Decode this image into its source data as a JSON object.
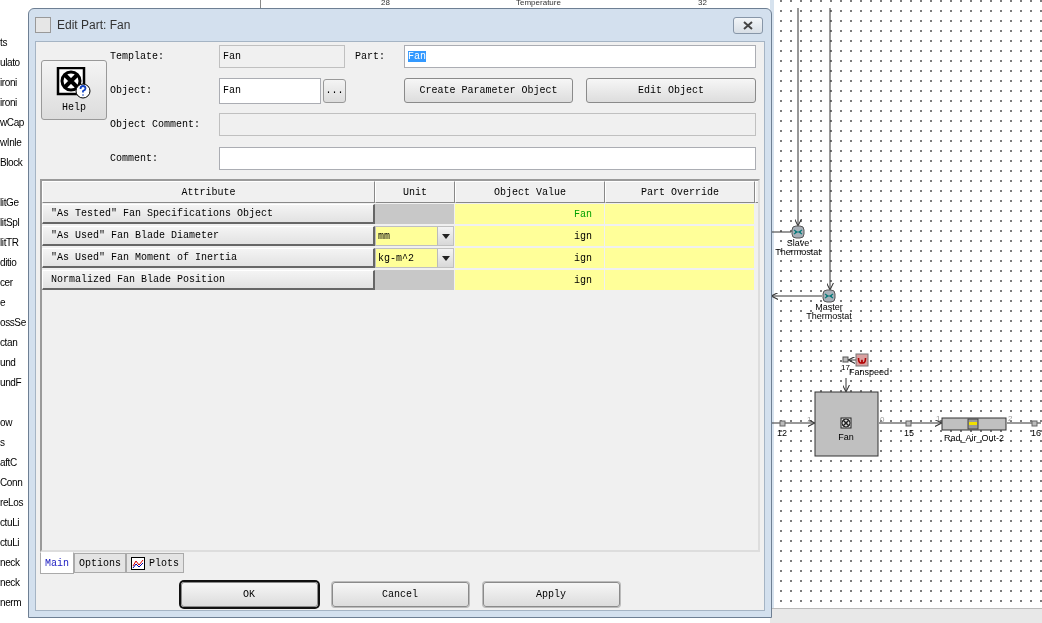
{
  "background": {
    "top_ruler": [
      "28",
      "Temperature",
      "32"
    ],
    "left_list": [
      {
        "items": [
          "ts",
          "ulato",
          "ironi",
          "ironi",
          "wCap",
          "wInle",
          "Block"
        ]
      },
      {
        "items": [
          "litGe",
          "litSpl",
          "litTR",
          "ditio",
          "cer",
          "e",
          "ossSe",
          "ctan",
          "und",
          "undF"
        ]
      },
      {
        "items": [
          "ow",
          "s",
          "aftC",
          "Conn",
          "reLos",
          "ctuLi",
          "ctuLi",
          "neck",
          "neck",
          "nerm"
        ]
      }
    ]
  },
  "diagram": {
    "thermostats": [
      {
        "lines": [
          "Slave",
          "Thermostat"
        ]
      },
      {
        "lines": [
          "Master",
          "Thermostat"
        ]
      }
    ],
    "signal": {
      "port": "17",
      "label": "Fanspeed"
    },
    "fan": {
      "label": "Fan",
      "port_in": "1",
      "port_out": "0"
    },
    "radiator": {
      "label": "Rad_Air_Out-2",
      "port_in": "1",
      "port_out": "2"
    },
    "links": [
      "12",
      "15",
      "16"
    ]
  },
  "dialog": {
    "title": "Edit Part: Fan",
    "help_button": "Help",
    "template": {
      "label": "Template:",
      "value": "Fan",
      "disabled": true
    },
    "part": {
      "label": "Part:",
      "value": "Fan",
      "disabled": false,
      "text_selected": true
    },
    "object": {
      "label": "Object:",
      "value": "Fan",
      "disabled": false
    },
    "browse_button": "...",
    "create_button": "Create Parameter Object",
    "edit_button": "Edit Object",
    "object_comment": {
      "label": "Object Comment:",
      "disabled": true
    },
    "comment": {
      "label": "Comment:",
      "disabled": false
    },
    "table": {
      "columns": [
        "Attribute",
        "Unit",
        "Object Value",
        "Part Override"
      ],
      "rows": [
        {
          "attribute": "\"As Tested\" Fan Specifications Object",
          "unit": {
            "kind": "none"
          },
          "value": "Fan",
          "color": "#00a000"
        },
        {
          "attribute": "\"As Used\" Fan Blade Diameter",
          "unit": {
            "kind": "dropdown",
            "value": "mm"
          },
          "value": "ign"
        },
        {
          "attribute": "\"As Used\" Fan Moment of Inertia",
          "unit": {
            "kind": "dropdown",
            "value": "kg-m^2"
          },
          "value": "ign"
        },
        {
          "attribute": "Normalized Fan Blade Position",
          "unit": {
            "kind": "none"
          },
          "value": "ign"
        }
      ]
    },
    "tabs": [
      {
        "label": "Main",
        "selected": true,
        "icon": false
      },
      {
        "label": "Options",
        "selected": false,
        "icon": false
      },
      {
        "label": "Plots",
        "selected": false,
        "icon": true
      }
    ],
    "buttons": [
      {
        "label": "OK",
        "default": true
      },
      {
        "label": "Cancel",
        "default": false
      },
      {
        "label": "Apply",
        "default": false
      }
    ]
  }
}
